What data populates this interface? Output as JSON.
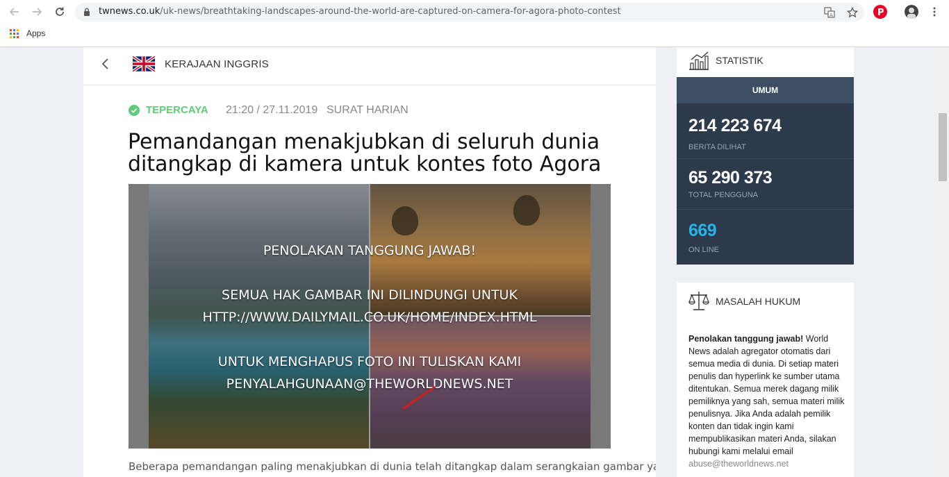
{
  "browser": {
    "url_domain": "twnews.co.uk",
    "url_path": "/uk-news/breathtaking-landscapes-around-the-world-are-captured-on-camera-for-agora-photo-contest",
    "bookmarks_apps_label": "Apps",
    "icons": [
      "back-arrow-icon",
      "forward-arrow-icon",
      "reload-icon",
      "lock-icon",
      "translate-icon",
      "star-icon",
      "pinterest-icon",
      "profile-avatar",
      "menu-dots-icon",
      "apps-grid-icon"
    ]
  },
  "article": {
    "country": "KERAJAAN INGGRIS",
    "trusted_label": "TEPERCAYA",
    "datetime": "21:20 / 27.11.2019",
    "source": "SURAT HARIAN",
    "headline": "Pemandangan menakjubkan di seluruh dunia ditangkap di kamera untuk kontes foto Agora",
    "image_overlay": {
      "line1": "PENOLAKAN TANGGUNG JAWAB!",
      "line2": "SEMUA HAK GAMBAR INI DILINDUNGI UNTUK",
      "line3": "HTTP://WWW.DAILYMAIL.CO.UK/HOME/INDEX.HTML",
      "line4": "UNTUK MENGHAPUS FOTO INI TULISKAN KAMI",
      "line5": "PENYALAHGUNAAN@THEWORLDNEWS.NET"
    },
    "lead": "Beberapa pemandangan paling menakjubkan di dunia telah ditangkap dalam serangkaian gambar yang"
  },
  "stats": {
    "title": "STATISTIK",
    "tab": "UMUM",
    "rows": [
      {
        "value": "214 223 674",
        "label": "BERITA DILIHAT"
      },
      {
        "value": "65 290 373",
        "label": "TOTAL PENGGUNA"
      },
      {
        "value": "669",
        "label": "ON LINE"
      }
    ]
  },
  "legal": {
    "title": "MASALAH HUKUM",
    "bold_lead": "Penolakan tanggung jawab!",
    "body": " World News adalah agregator otomatis dari semua media di dunia. Di setiap materi penulis dan hyperlink ke sumber utama ditentukan. Semua merek dagang milik pemiliknya yang sah, semua materi milik penulisnya. Jika Anda adalah pemilik konten dan tidak ingin kami mempublikasikan materi Anda, silakan hubungi kami melalui email",
    "email": "abuse@theworldnews.net"
  },
  "colors": {
    "trusted_green": "#5ecb7b",
    "stats_bg": "#2c3a4b",
    "online_blue": "#27b4ea"
  }
}
